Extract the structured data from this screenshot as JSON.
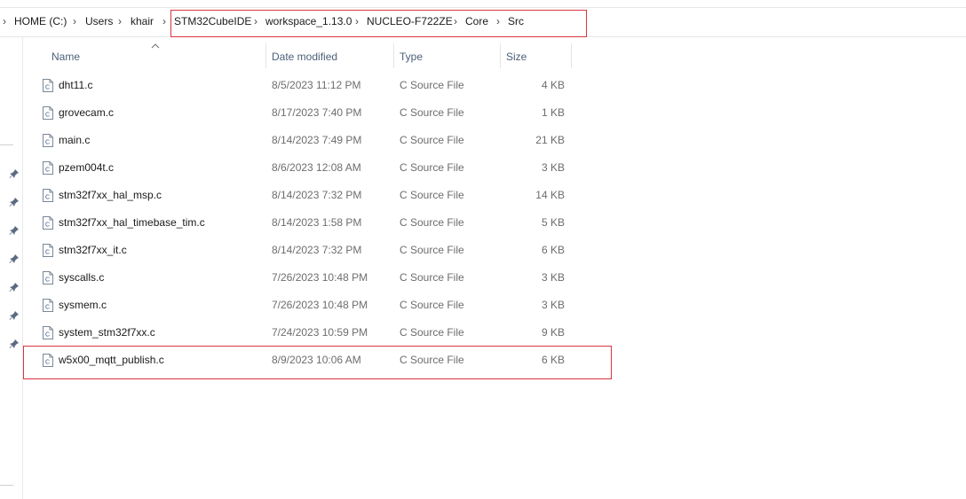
{
  "breadcrumb": {
    "items": [
      "HOME (C:)",
      "Users",
      "khair",
      "STM32CubeIDE",
      "workspace_1.13.0",
      "NUCLEO-F722ZE",
      "Core",
      "Src"
    ]
  },
  "columns": {
    "name": "Name",
    "date": "Date modified",
    "type": "Type",
    "size": "Size",
    "sort": "Name ascending"
  },
  "files": [
    {
      "name": "dht11.c",
      "date": "8/5/2023 11:12 PM",
      "type": "C Source File",
      "size": "4 KB"
    },
    {
      "name": "grovecam.c",
      "date": "8/17/2023 7:40 PM",
      "type": "C Source File",
      "size": "1 KB"
    },
    {
      "name": "main.c",
      "date": "8/14/2023 7:49 PM",
      "type": "C Source File",
      "size": "21 KB"
    },
    {
      "name": "pzem004t.c",
      "date": "8/6/2023 12:08 AM",
      "type": "C Source File",
      "size": "3 KB"
    },
    {
      "name": "stm32f7xx_hal_msp.c",
      "date": "8/14/2023 7:32 PM",
      "type": "C Source File",
      "size": "14 KB"
    },
    {
      "name": "stm32f7xx_hal_timebase_tim.c",
      "date": "8/14/2023 1:58 PM",
      "type": "C Source File",
      "size": "5 KB"
    },
    {
      "name": "stm32f7xx_it.c",
      "date": "8/14/2023 7:32 PM",
      "type": "C Source File",
      "size": "6 KB"
    },
    {
      "name": "syscalls.c",
      "date": "7/26/2023 10:48 PM",
      "type": "C Source File",
      "size": "3 KB"
    },
    {
      "name": "sysmem.c",
      "date": "7/26/2023 10:48 PM",
      "type": "C Source File",
      "size": "3 KB"
    },
    {
      "name": "system_stm32f7xx.c",
      "date": "7/24/2023 10:59 PM",
      "type": "C Source File",
      "size": "9 KB"
    },
    {
      "name": "w5x00_mqtt_publish.c",
      "date": "8/9/2023 10:06 AM",
      "type": "C Source File",
      "size": "6 KB"
    }
  ],
  "icons": {
    "file": "c-source-file-icon",
    "pin": "pin-icon",
    "separator": "chevron-right-icon",
    "sort": "sort-up-caret-icon"
  },
  "colors": {
    "highlight": "#d9363e",
    "header_text": "#4c607a",
    "muted_text": "#6d6d6d"
  }
}
